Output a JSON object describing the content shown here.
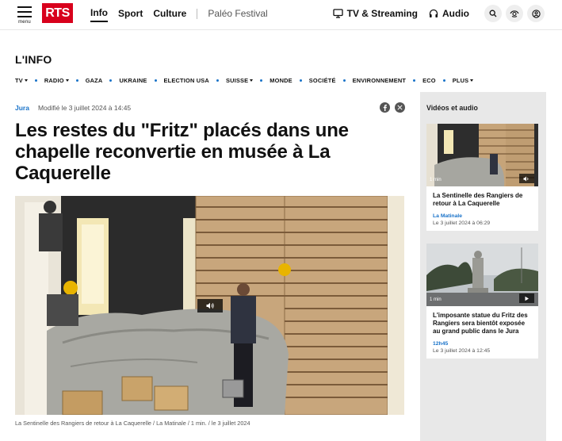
{
  "header": {
    "menu_label": "menu",
    "logo_text": "RTS",
    "nav": [
      {
        "label": "Info"
      },
      {
        "label": "Sport"
      },
      {
        "label": "Culture"
      }
    ],
    "festival_label": "Paléo Festival",
    "tv_label": "TV & Streaming",
    "audio_label": "Audio"
  },
  "section": {
    "title": "L'INFO",
    "subnav": [
      {
        "label": "TV",
        "dropdown": true
      },
      {
        "label": "RADIO",
        "dropdown": true
      },
      {
        "label": "GAZA",
        "dropdown": false
      },
      {
        "label": "UKRAINE",
        "dropdown": false
      },
      {
        "label": "ELECTION USA",
        "dropdown": false
      },
      {
        "label": "SUISSE",
        "dropdown": true
      },
      {
        "label": "MONDE",
        "dropdown": false
      },
      {
        "label": "SOCIÉTÉ",
        "dropdown": false
      },
      {
        "label": "ENVIRONNEMENT",
        "dropdown": false
      },
      {
        "label": "ECO",
        "dropdown": false
      },
      {
        "label": "PLUS",
        "dropdown": true
      }
    ]
  },
  "article": {
    "region": "Jura",
    "modified": "Modifié le 3 juillet 2024 à 14:45",
    "headline": "Les restes du \"Fritz\" placés dans une chapelle reconvertie en musée à La Caquerelle",
    "caption": "La Sentinelle des Rangiers de retour à La Caquerelle / La Matinale / 1 min. / le 3 juillet 2024"
  },
  "sidebar": {
    "title": "Vidéos et audio",
    "cards": [
      {
        "duration": "1 min",
        "title": "La Sentinelle des Rangiers de retour à La Caquerelle",
        "show": "La Matinale",
        "date": "Le 3 juillet 2024 à 06:29"
      },
      {
        "duration": "1 min",
        "title": "L'imposante statue du Fritz des Rangiers sera bientôt exposée au grand public dans le Jura",
        "show": "12h45",
        "date": "Le 3 juillet 2024 à 12:45"
      }
    ]
  },
  "colors": {
    "brand": "#d8001c",
    "link": "#1a73c9"
  }
}
